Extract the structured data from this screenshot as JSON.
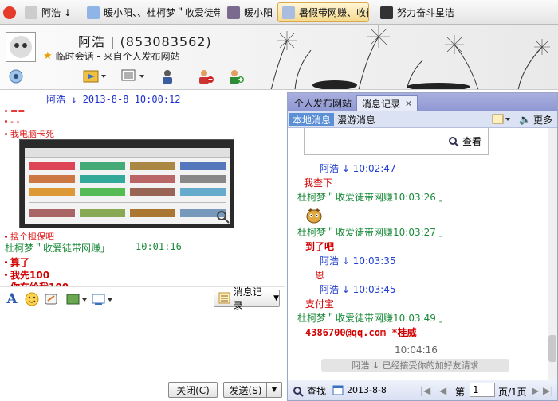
{
  "tabs": [
    {
      "label": "阿浩 ↓",
      "active": false
    },
    {
      "label": "暖小阳、、杜柯梦＂收爱徒带",
      "active": false
    },
    {
      "label": "暖小阳",
      "active": false
    },
    {
      "label": "暑假带网赚、收徒",
      "active": true
    },
    {
      "label": "努力奋斗星洁",
      "active": false
    }
  ],
  "header": {
    "name": "阿浩 | (853083562)",
    "subtitle": "临时会话 - 来自个人发布网站"
  },
  "toolbar_icons": [
    "camera-icon",
    "send-file-icon",
    "screen-icon",
    "contacts-icon",
    "block-icon",
    "add-friend-icon"
  ],
  "chat": {
    "header": "阿浩 ↓ 2013-8-8 10:00:12",
    "lines": [
      "==",
      "- -",
      "我电脑卡死"
    ],
    "after_image": "搜个担保吧",
    "sender": "杜柯梦＂收爱徒带网赚」",
    "sender_time": "10:01:16",
    "red_lines": [
      "算了",
      "我先100",
      "你在给我100"
    ]
  },
  "format_bar": {
    "history_label": "消息记录"
  },
  "footer": {
    "close_label": "关闭(C)",
    "send_label": "发送(S)"
  },
  "right": {
    "tabs": [
      "个人发布网站",
      "消息记录"
    ],
    "subtabs": [
      "本地消息",
      "漫游消息"
    ],
    "more_label": "更多",
    "view_label": "查看",
    "messages": [
      {
        "text": "阿浩 ↓ 10:02:47",
        "color": "#1f3fcf"
      },
      {
        "text": "我查下",
        "color": "#d00000"
      },
      {
        "text": "杜柯梦＂收爱徒带网赚10:03:26 」",
        "color": "#1a8a3a"
      },
      {
        "text": "杜柯梦＂收爱徒带网赚10:03:27 」",
        "color": "#1a8a3a"
      },
      {
        "text": "到了吧",
        "color": "#d00000"
      },
      {
        "text": "阿浩 ↓ 10:03:35",
        "color": "#1f3fcf"
      },
      {
        "text": "恩",
        "color": "#d00000"
      },
      {
        "text": "阿浩 ↓ 10:03:45",
        "color": "#1f3fcf"
      },
      {
        "text": "支付宝",
        "color": "#d00000"
      },
      {
        "text": "杜柯梦＂收爱徒带网赚10:03:49 」",
        "color": "#1a8a3a"
      },
      {
        "text": "4386700@qq.com  *桂威",
        "color": "#d00000"
      },
      {
        "text": "10:04:16",
        "color": "#666666"
      }
    ],
    "notice": "阿浩 ↓ 已经接受你的加好友请求",
    "find_label": "查找",
    "date_label": "2013-8-8",
    "page_prefix": "第",
    "page_value": "1",
    "page_suffix": "页/1页"
  }
}
